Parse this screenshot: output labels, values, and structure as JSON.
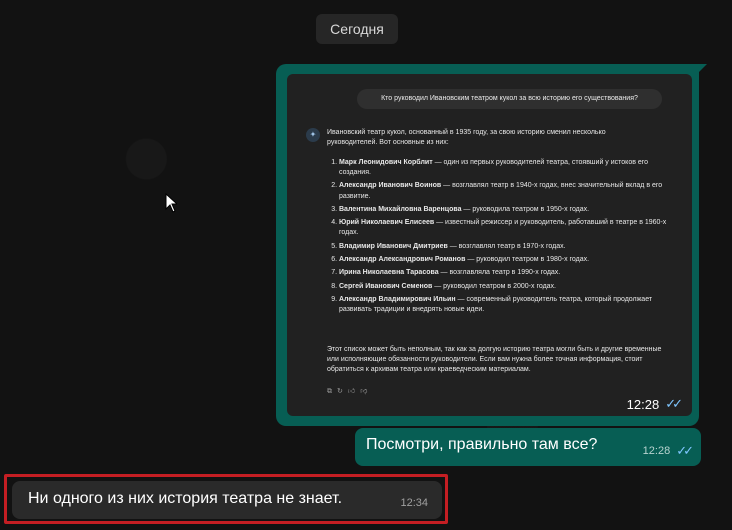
{
  "chat": {
    "date_separator": "Сегодня",
    "image_message": {
      "time": "12:28",
      "screenshot": {
        "question": "Кто руководил Ивановским театром кукол за всю историю его существования?",
        "intro": "Ивановский театр кукол, основанный в 1935 году, за свою историю сменил несколько руководителей. Вот основные из них:",
        "items": [
          {
            "name": "Марк Леонидович Корблит",
            "text": " — один из первых руководителей театра, стоявший у истоков его создания."
          },
          {
            "name": "Александр Иванович Воинов",
            "text": " — возглавлял театр в 1940-х годах, внес значительный вклад в его развитие."
          },
          {
            "name": "Валентина Михайловна Варенцова",
            "text": " — руководила театром в 1950-х годах."
          },
          {
            "name": "Юрий Николаевич Елисеев",
            "text": " — известный режиссер и руководитель, работавший в театре в 1960-х годах."
          },
          {
            "name": "Владимир Иванович Дмитриев",
            "text": " — возглавлял театр в 1970-х годах."
          },
          {
            "name": "Александр Александрович Романов",
            "text": " — руководил театром в 1980-х годах."
          },
          {
            "name": "Ирина Николаевна Тарасова",
            "text": " — возглавляла театр в 1990-х годах."
          },
          {
            "name": "Сергей Иванович Семенов",
            "text": " — руководил театром в 2000-х годах."
          },
          {
            "name": "Александр Владимирович Ильин",
            "text": " — современный руководитель театра, который продолжает развивать традиции и внедрять новые идеи."
          }
        ],
        "outro": "Этот список может быть неполным, так как за долгую историю театра могли быть и другие временные или исполняющие обязанности руководители. Если вам нужна более точная информация, стоит обратиться к архивам театра или краеведческим материалам."
      }
    },
    "outgoing_message": {
      "text": "Посмотри, правильно там все?",
      "time": "12:28"
    },
    "incoming_message": {
      "text": "Ни одного из них история театра не знает.",
      "time": "12:34"
    }
  },
  "colors": {
    "outgoing_bubble": "#075e54",
    "incoming_bubble": "#2a2a2a",
    "highlight_border": "#c41e23",
    "read_ticks": "#7fc6ff"
  }
}
